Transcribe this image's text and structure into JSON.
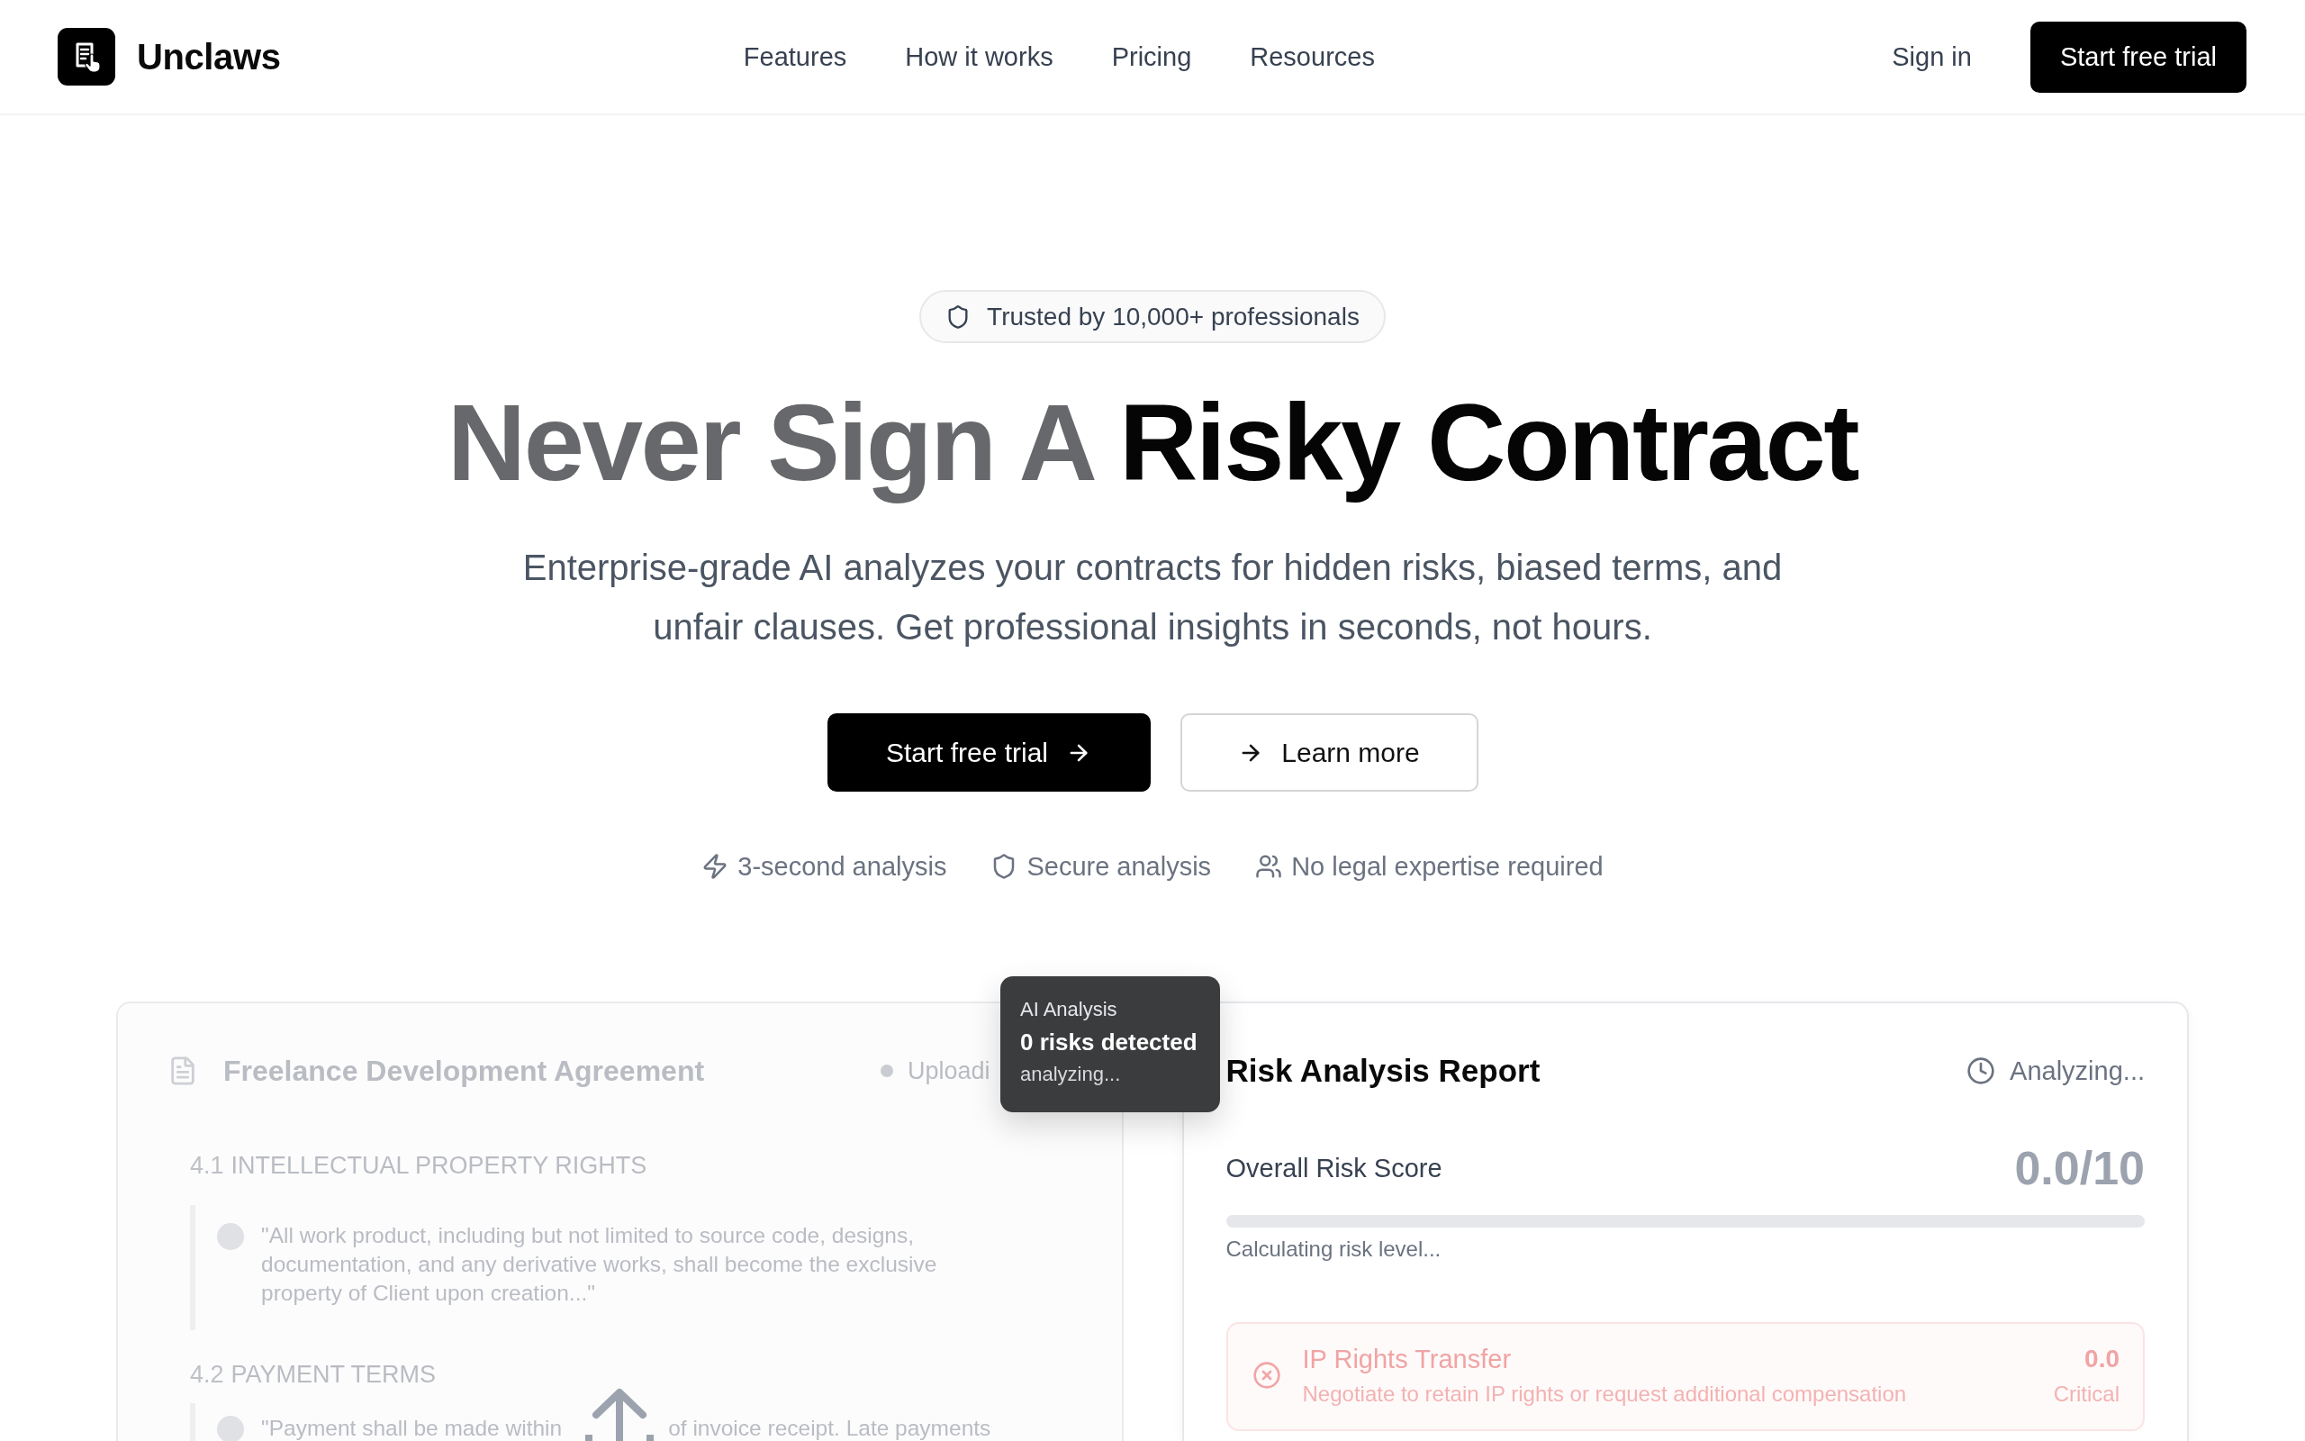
{
  "header": {
    "brand": "Unclaws",
    "nav": [
      "Features",
      "How it works",
      "Pricing",
      "Resources"
    ],
    "sign_in": "Sign in",
    "cta": "Start free trial"
  },
  "hero": {
    "badge": "Trusted by 10,000+ professionals",
    "heading": {
      "lead": "Never Sign A",
      "emphasis": "Risky Contract"
    },
    "subtitle": "Enterprise-grade AI analyzes your contracts for hidden risks, biased terms, and unfair clauses. Get professional insights in seconds, not hours.",
    "buttons": [
      {
        "label": "Start free trial",
        "kind": "primary"
      },
      {
        "label": "Learn more",
        "kind": "secondary"
      }
    ],
    "features": [
      "3-second analysis",
      "Secure analysis",
      "No legal expertise required"
    ]
  },
  "document_panel": {
    "title": "Freelance Development Agreement",
    "status": "Uploadi",
    "sections": [
      {
        "number": "4.1",
        "title": "INTELLECTUAL PROPERTY RIGHTS",
        "clauses": [
          {
            "parts": [
              "\"All work product, including but not limited to source code, designs, documentation, and any derivative works, shall become the exclusive property of Client upon creation...\""
            ]
          }
        ]
      },
      {
        "number": "4.2",
        "title": "PAYMENT TERMS",
        "clauses": [
          {
            "parts": [
              "\"Payment shall be made within",
              "of invoice receipt. Late payments"
            ]
          }
        ]
      }
    ]
  },
  "analysis_tooltip": {
    "title": "AI Analysis",
    "count": "0 risks detected",
    "status": "analyzing..."
  },
  "report_panel": {
    "title": "Risk Analysis Report",
    "status": "Analyzing...",
    "score_label": "Overall Risk Score",
    "score": "0.0/10",
    "risk_meter": {
      "level": 0
    },
    "meter_caption": "Calculating risk level...",
    "risks": [
      {
        "title": "IP Rights Transfer",
        "recommendation": "Negotiate to retain IP rights or request additional compensation",
        "score": "0.0",
        "severity": "Critical"
      }
    ]
  }
}
